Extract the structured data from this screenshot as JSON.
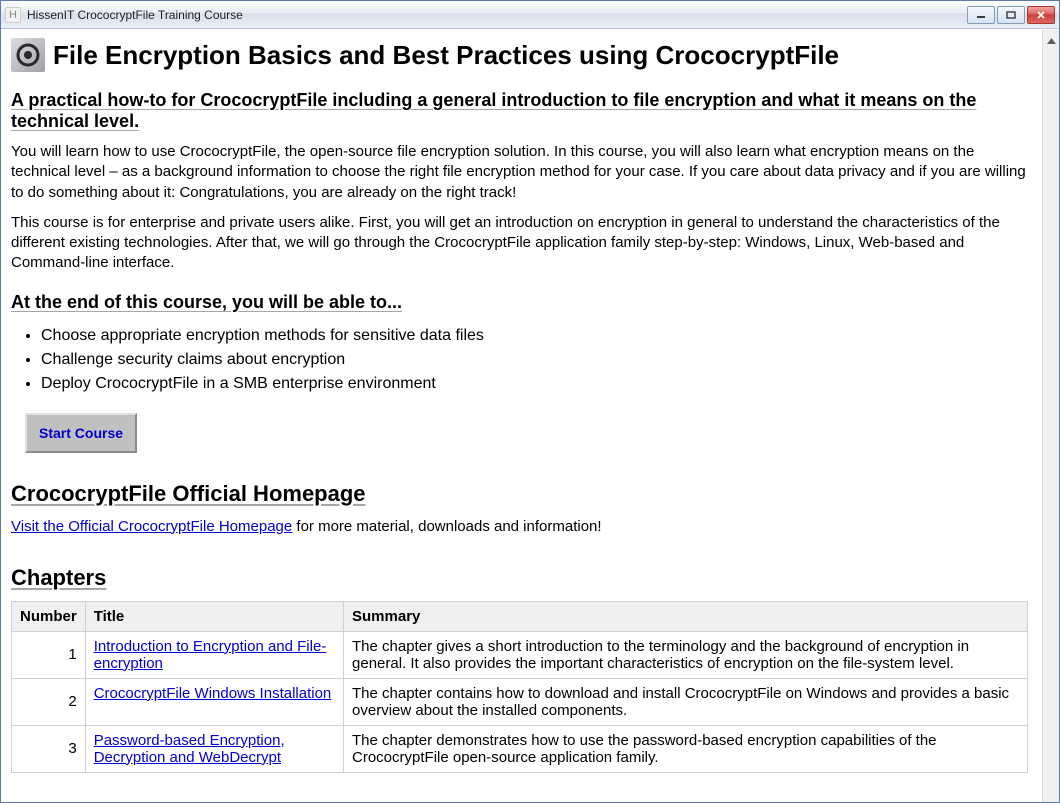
{
  "window": {
    "title": "HissenIT CrococryptFile Training Course",
    "app_icon_letter": "H"
  },
  "page": {
    "title": "File Encryption Basics and Best Practices using CrococryptFile",
    "subtitle": "A practical how-to for CrococryptFile including a general introduction to file encryption and what it means on the technical level.",
    "para1": "You will learn how to use CrococryptFile, the open-source file encryption solution. In this course, you will also learn what encryption means on the technical level – as a background information to choose the right file encryption method for your case. If you care about data privacy and if you are willing to do something about it: Congratulations, you are already on the right track!",
    "para2": "This course is for enterprise and private users alike. First, you will get an introduction on encryption in general to understand the characteristics of the different existing technologies. After that, we will go through the CrococryptFile application family step-by-step: Windows, Linux, Web-based and Command-line interface.",
    "outcomes_heading": "At the end of this course, you will be able to...",
    "outcomes": [
      "Choose appropriate encryption methods for sensitive data files",
      "Challenge security claims about encryption",
      "Deploy CrococryptFile in a SMB enterprise environment"
    ],
    "start_button": "Start Course",
    "homepage_heading": "CrococryptFile Official Homepage",
    "homepage_link": "Visit the Official CrococryptFile Homepage",
    "homepage_tail": " for more material, downloads and information!",
    "chapters_heading": "Chapters",
    "table": {
      "headers": {
        "number": "Number",
        "title": "Title",
        "summary": "Summary"
      },
      "rows": [
        {
          "num": "1",
          "title": "Introduction to Encryption and File-encryption",
          "summary": "The chapter gives a short introduction to the terminology and the background of encryption in general. It also provides the important characteristics of encryption on the file-system level."
        },
        {
          "num": "2",
          "title": "CrococryptFile Windows Installation",
          "summary": "The chapter contains how to download and install CrococryptFile on Windows and provides a basic overview about the installed components."
        },
        {
          "num": "3",
          "title": "Password-based Encryption, Decryption and WebDecrypt",
          "summary": "The chapter demonstrates how to use the password-based encryption capabilities of the CrococryptFile open-source application family."
        }
      ]
    }
  }
}
